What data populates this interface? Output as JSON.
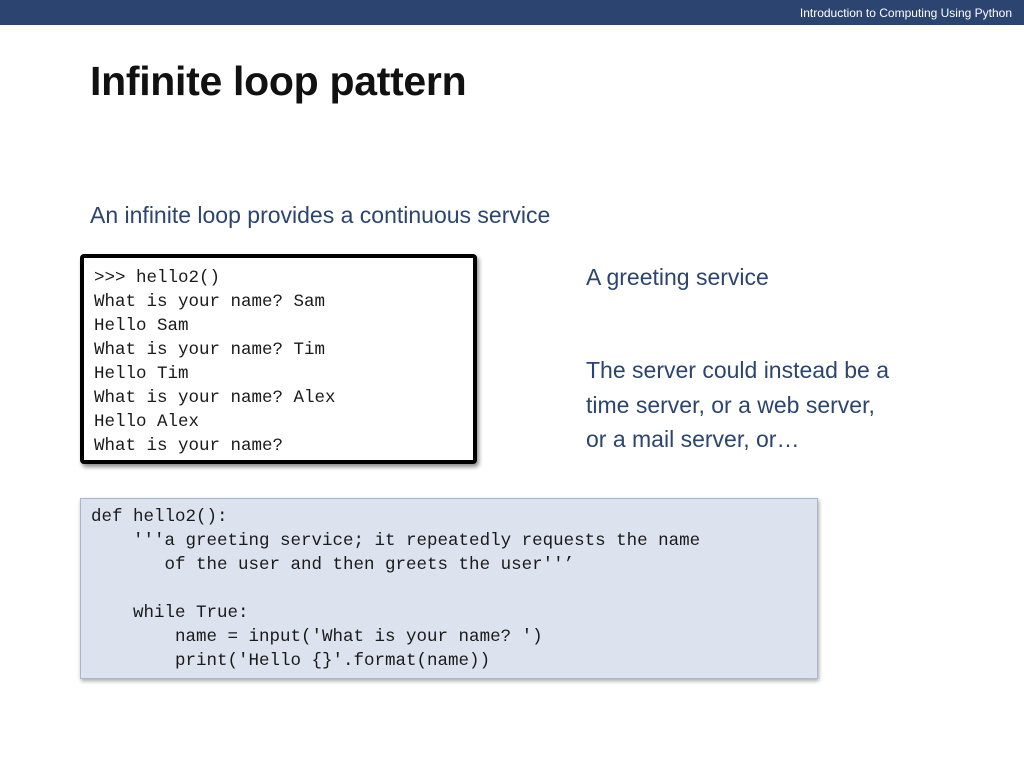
{
  "header": {
    "course_title": "Introduction to Computing Using Python"
  },
  "slide": {
    "title": "Infinite loop pattern",
    "subtitle": "An infinite loop provides a continuous service",
    "side_heading": "A greeting service",
    "side_text_lines": [
      "The server could instead be a",
      "time server, or a web server,",
      "or a mail server, or…"
    ]
  },
  "shell": {
    "lines": [
      ">>> hello2()",
      "What is your name? Sam",
      "Hello Sam",
      "What is your name? Tim",
      "Hello Tim",
      "What is your name? Alex",
      "Hello Alex",
      "What is your name?"
    ]
  },
  "code": {
    "lines": [
      "def hello2():",
      "    '''a greeting service; it repeatedly requests the name",
      "       of the user and then greets the user''’",
      "",
      "    while True:",
      "        name = input('What is your name? ')",
      "        print('Hello {}'.format(name))"
    ]
  },
  "colors": {
    "header_bar": "#2b4570",
    "accent_text": "#2b4570",
    "code_background": "#dde3ee"
  }
}
